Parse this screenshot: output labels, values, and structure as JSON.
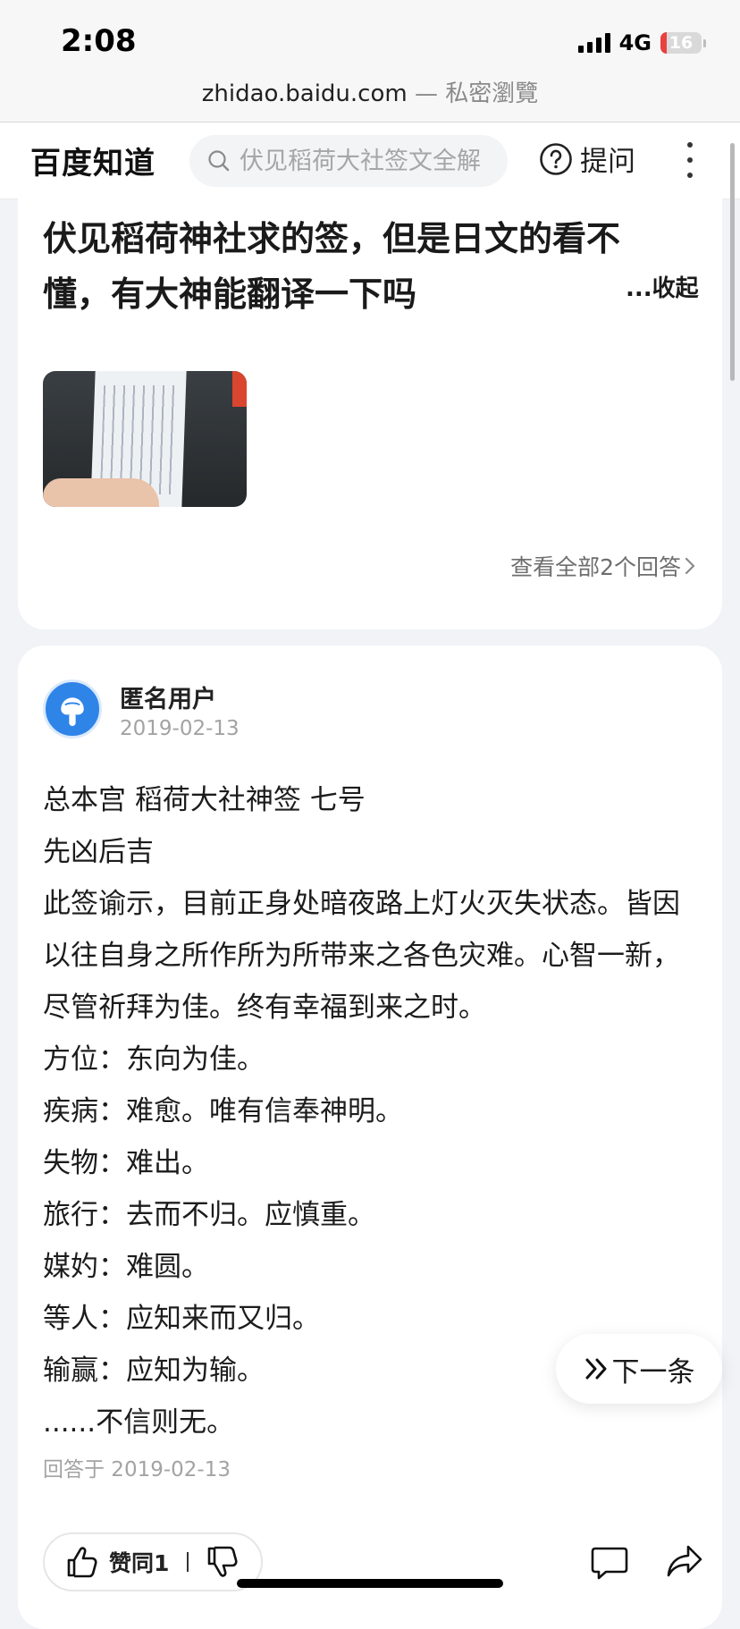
{
  "status_bar": {
    "time": "2:08",
    "network": "4G",
    "battery": "16",
    "battery_level": 0.16,
    "signal_bars": 4
  },
  "browser": {
    "domain": "zhidao.baidu.com",
    "separator": "—",
    "mode": "私密瀏覽"
  },
  "header": {
    "logo": "百度知道",
    "search": {
      "placeholder": "伏见稻荷大社签文全解",
      "value": ""
    },
    "ask_label": "提问",
    "icons": {
      "search": "search-icon",
      "ask": "question-circle-icon",
      "more": "more-vertical-icon"
    }
  },
  "question": {
    "title": "伏见稻荷神社求的签，但是日文的看不懂，有大神能翻译一下吗",
    "collapse_label": "...收起",
    "view_all_label": "查看全部2个回答"
  },
  "answer": {
    "user_name": "匿名用户",
    "date": "2019-02-13",
    "lines": [
      "总本宫 稻荷大社神签 七号",
      "先凶后吉",
      "此签谕示，目前正身处暗夜路上灯火灭失状态。皆因以往自身之所作所为所带来之各色灾难。心智一新，尽管祈拜为佳。终有幸福到来之时。",
      "方位：东向为佳。",
      "疾病：难愈。唯有信奉神明。",
      "失物：难出。",
      "旅行：去而不归。应慎重。",
      "媒妁：难圆。",
      "等人：应知来而又归。",
      "输赢：应知为输。",
      "......不信则无。"
    ],
    "answered_at": "回答于 2019-02-13",
    "vote_label": "赞同1",
    "icons": {
      "avatar": "anonymous-user-avatar",
      "upvote": "thumbs-up-icon",
      "downvote": "thumbs-down-icon",
      "comment": "comment-icon",
      "share": "share-icon"
    }
  },
  "floating": {
    "next_label": "下一条",
    "icon": "double-chevron-right-icon"
  },
  "colors": {
    "background": "#f2f3f7",
    "card": "#ffffff",
    "text": "#1f1f1f",
    "muted": "#a3a3a3",
    "avatar": "#2f84e8",
    "battery_low": "#e94040"
  }
}
